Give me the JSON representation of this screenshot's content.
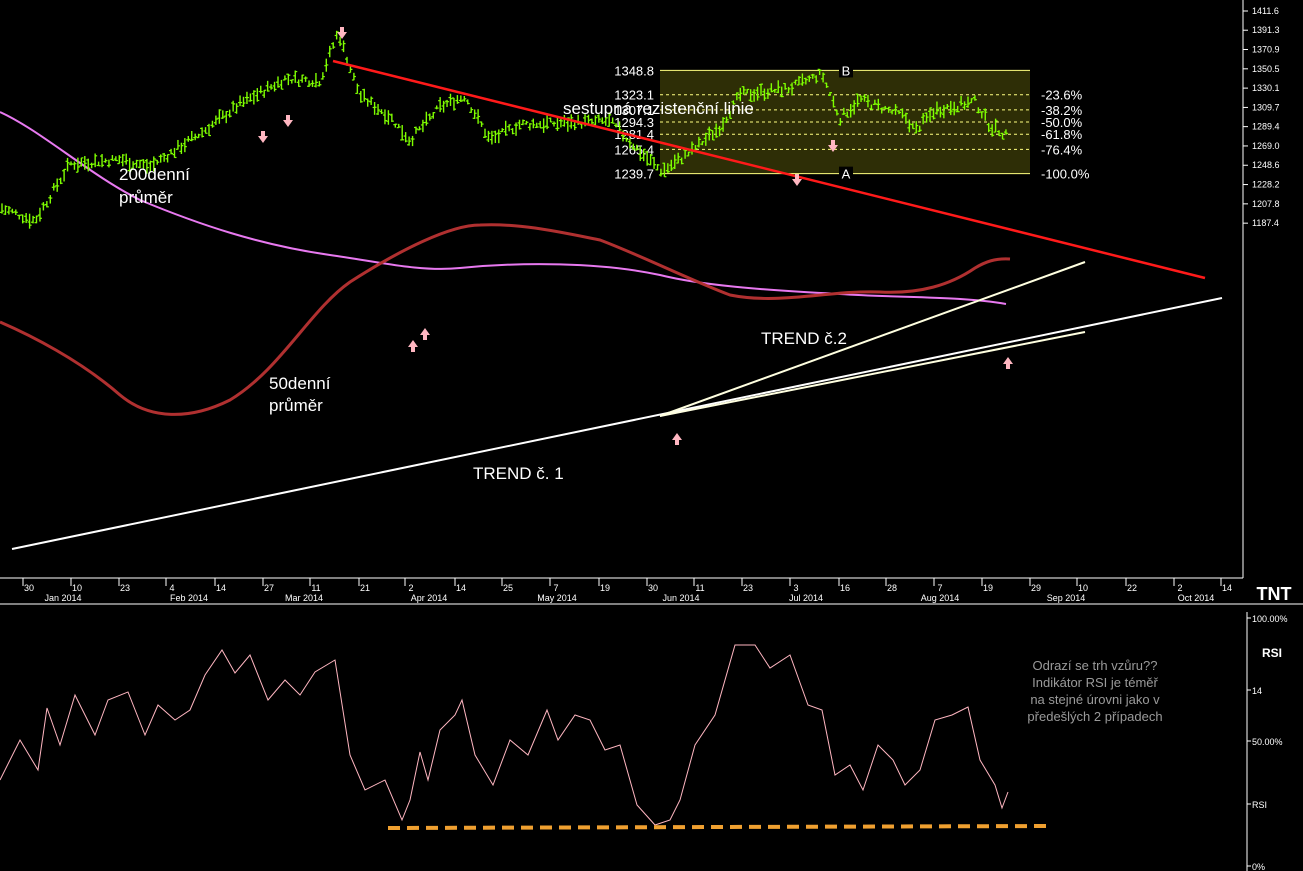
{
  "chart_data": [
    {
      "type": "ohlc",
      "instrument_axis": "price",
      "yticks": [
        "1411.6",
        "1391.3",
        "1370.9",
        "1350.5",
        "1330.1",
        "1309.7",
        "1289.4",
        "1269.0",
        "1248.6",
        "1228.2",
        "1207.8",
        "1187.4"
      ],
      "ylim": [
        1170.0,
        1415.0
      ],
      "xaxis": {
        "days": [
          "30",
          "10",
          "23",
          "4",
          "14",
          "27",
          "11",
          "21",
          "2",
          "14",
          "25",
          "7",
          "19",
          "30",
          "11",
          "23",
          "3",
          "16",
          "28",
          "7",
          "19",
          "29",
          "10",
          "22",
          "2",
          "14"
        ],
        "months": [
          "Jan 2014",
          "Feb 2014",
          "Mar 2014",
          "Apr 2014",
          "May 2014",
          "Jun 2014",
          "Jul 2014",
          "Aug 2014",
          "Sep 2014",
          "Oct 2014"
        ]
      },
      "series": [
        {
          "name": "200denní průměr",
          "color": "#e879f0"
        },
        {
          "name": "50denní průměr",
          "color": "#b03030"
        }
      ],
      "fibonacci": {
        "box_color": "#2e2e06",
        "levels": [
          {
            "price": "1348.8",
            "pct": "",
            "tag": "B"
          },
          {
            "price": "1323.1",
            "pct": "-23.6%"
          },
          {
            "price": "1307.1",
            "pct": "-38.2%"
          },
          {
            "price": "1294.3",
            "pct": "-50.0%"
          },
          {
            "price": "1281.4",
            "pct": "-61.8%"
          },
          {
            "price": "1265.4",
            "pct": "-76.4%"
          },
          {
            "price": "1239.7",
            "pct": "-100.0%",
            "tag": "A"
          }
        ]
      },
      "annotations": {
        "resistance": "sestupná rezistenční linie",
        "ma200": [
          "200denní",
          "průměr"
        ],
        "ma50": [
          "50denní",
          "průměr"
        ],
        "trend1": "TREND č. 1",
        "trend2": "TREND č.2"
      },
      "colors": {
        "bars": "#7fff00",
        "resistance": "#ff1a1a",
        "trend": "#ffffff",
        "arrows": "#ffb6c1"
      }
    },
    {
      "type": "line",
      "name": "RSI",
      "yticks": [
        "100.00%",
        "14",
        "50.00%",
        "RSI",
        "0%"
      ],
      "ylim": [
        0,
        100
      ],
      "support_color": "#f0a030",
      "note": [
        "Odrazí se trh vzůru??",
        "Indikátor RSI je téměř",
        "na stejné úrovni jako v",
        "předešlých 2 případech"
      ]
    }
  ],
  "logo": "TNT"
}
